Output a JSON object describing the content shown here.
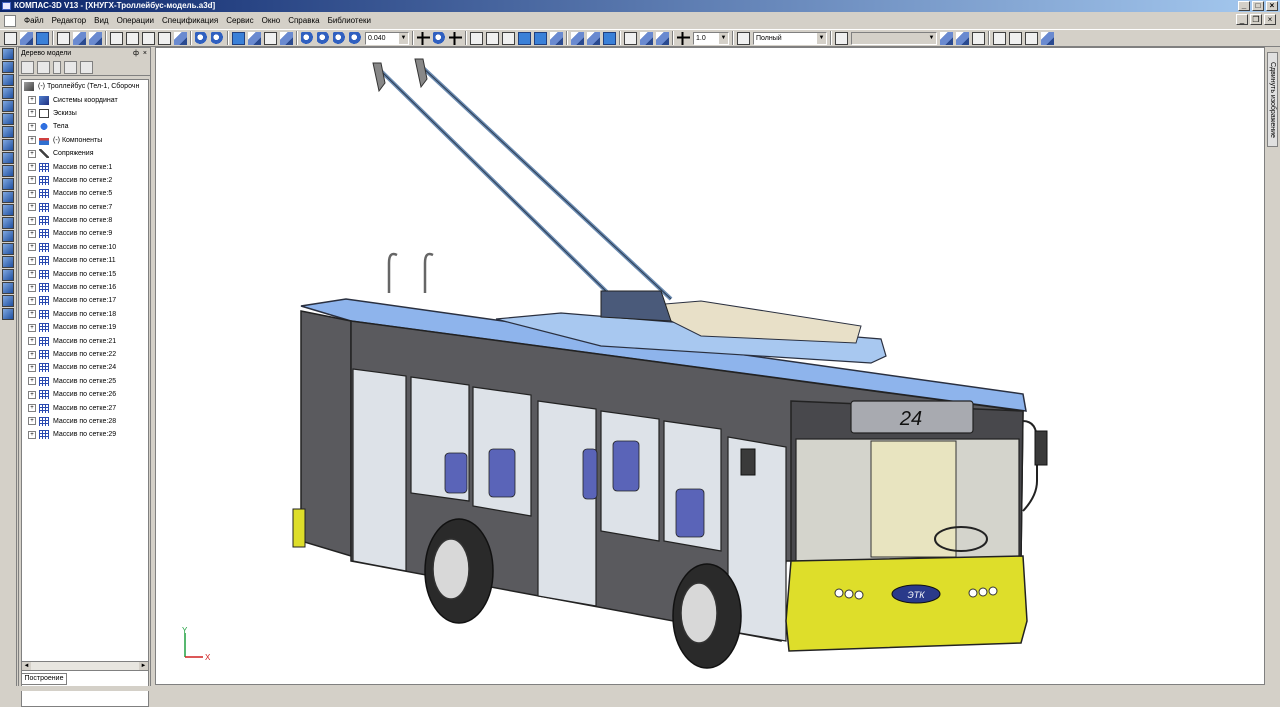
{
  "window": {
    "title": "КОМПАС-3D V13 - [ХНУГХ-Троллейбус-модель.a3d]"
  },
  "menu": [
    "Файл",
    "Редактор",
    "Вид",
    "Операции",
    "Спецификация",
    "Сервис",
    "Окно",
    "Справка",
    "Библиотеки"
  ],
  "toolbar": {
    "scale_value": "0.040",
    "step_value": "1.0",
    "style_value": "Полный"
  },
  "panel": {
    "title": "Дерево модели",
    "pin_glyph": "ф",
    "close_glyph": "×"
  },
  "tree": {
    "root": "(-) Троллейбус (Тел-1, Сборочн",
    "items": [
      "Системы координат",
      "Эскизы",
      "Тела",
      "(-) Компоненты",
      "Сопряжения",
      "Массив по сетке:1",
      "Массив по сетке:2",
      "Массив по сетке:5",
      "Массив по сетке:7",
      "Массив по сетке:8",
      "Массив по сетке:9",
      "Массив по сетке:10",
      "Массив по сетке:11",
      "Массив по сетке:15",
      "Массив по сетке:16",
      "Массив по сетке:17",
      "Массив по сетке:18",
      "Массив по сетке:19",
      "Массив по сетке:21",
      "Массив по сетке:22",
      "Массив по сетке:24",
      "Массив по сетке:25",
      "Массив по сетке:26",
      "Массив по сетке:27",
      "Массив по сетке:28",
      "Массив по сетке:29"
    ]
  },
  "bottom_tab": "Построение",
  "right_panel_label": "Сдвинуть изображение",
  "model": {
    "route_number": "24",
    "front_logo": "ЭТК"
  },
  "axes": {
    "x": "X",
    "y": "Y"
  },
  "colors": {
    "roof": "#8eb4ec",
    "body": "#5a5a5e",
    "bumper": "#dede2a",
    "titlebar": "#0a246a"
  }
}
